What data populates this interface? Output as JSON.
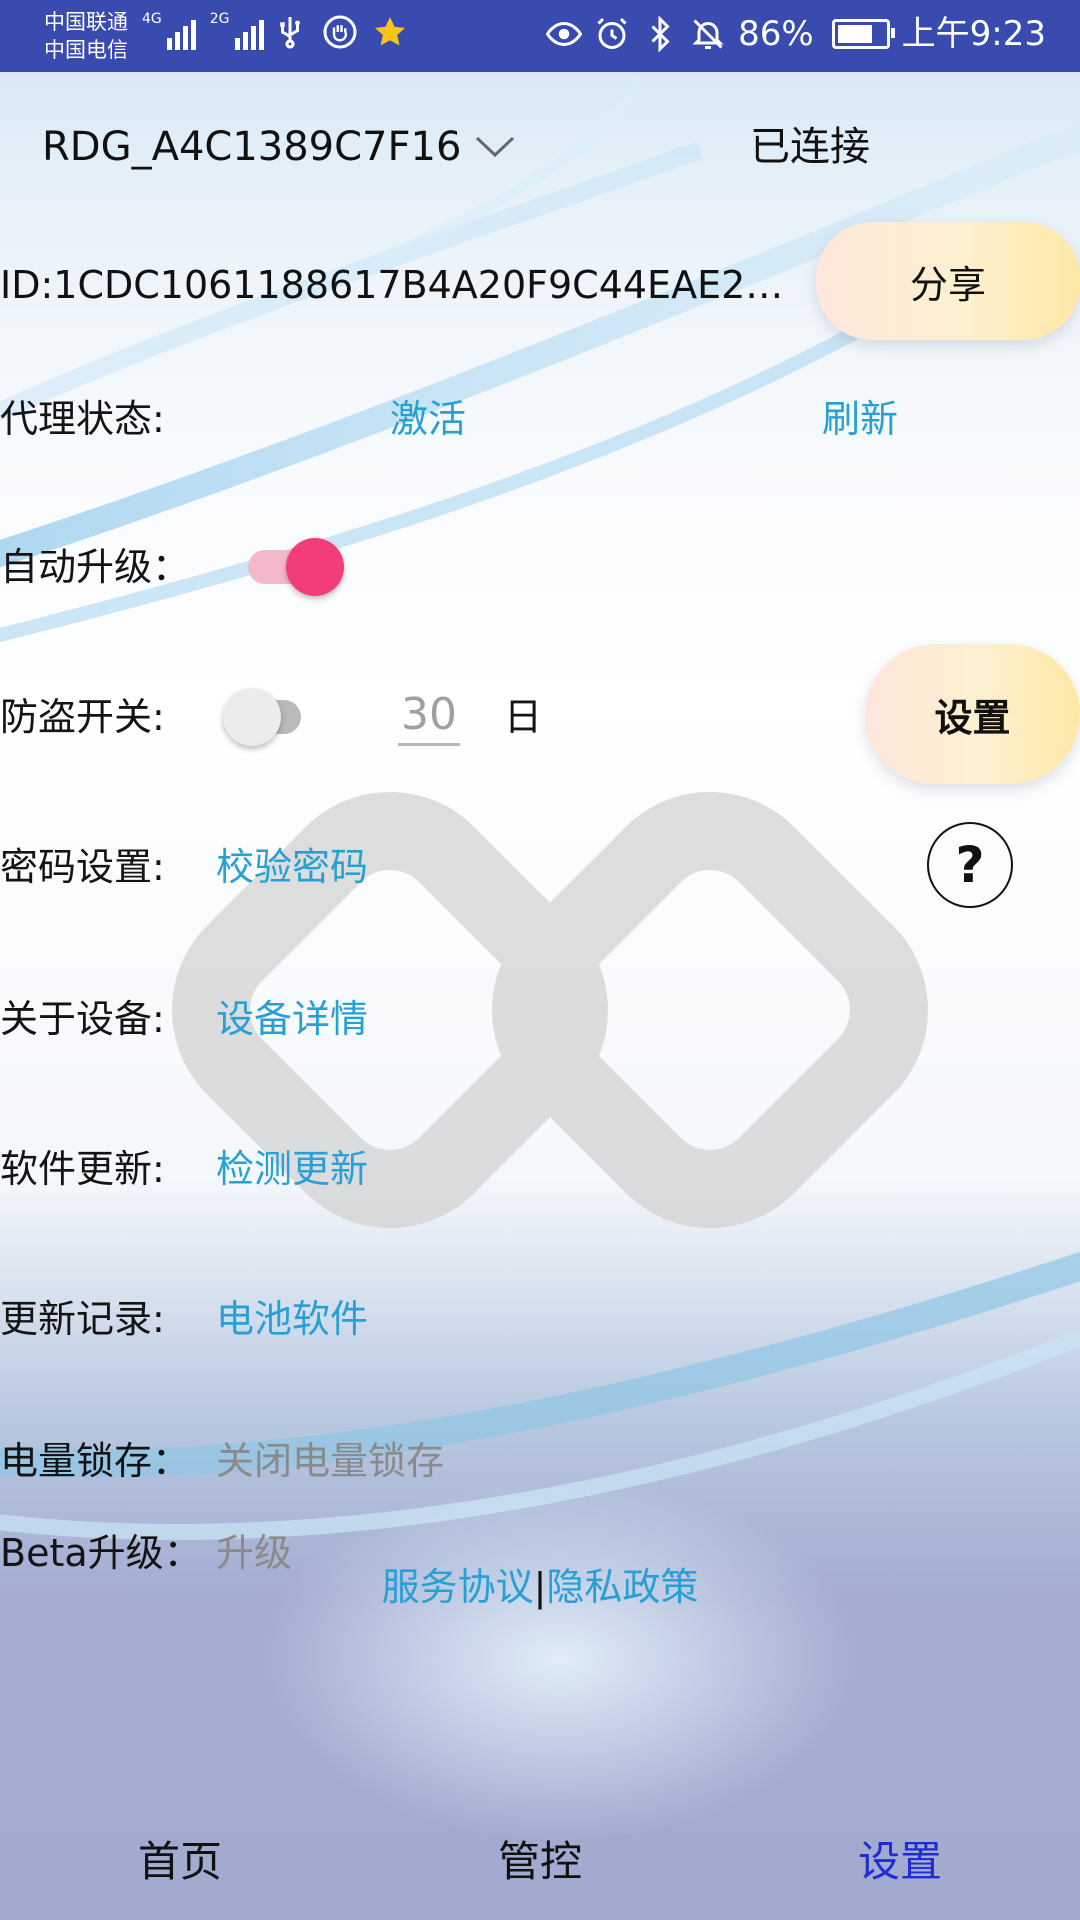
{
  "status_bar": {
    "carrier_1": "中国联通",
    "carrier_2": "中国电信",
    "net_1": "4G",
    "net_2": "2G",
    "battery_percent_text": "86%",
    "battery_level": 0.86,
    "time": "上午9:23"
  },
  "device": {
    "name": "RDG_A4C1389C7F16",
    "connection_status": "已连接",
    "id": "ID:1CDC1061188617B4A20F9C44EAE2C…",
    "share_label": "分享"
  },
  "settings": {
    "agent_status": {
      "label": "代理状态:",
      "activate": "激活",
      "refresh": "刷新"
    },
    "auto_upgrade": {
      "label": "自动升级：",
      "enabled": true
    },
    "anti_theft": {
      "label": "防盗开关:",
      "enabled": false,
      "days_value": "30",
      "days_unit": "日",
      "set_label": "设置"
    },
    "password": {
      "label": "密码设置:",
      "action": "校验密码"
    },
    "about": {
      "label": "关于设备:",
      "action": "设备详情"
    },
    "software_update": {
      "label": "软件更新:",
      "action": "检测更新"
    },
    "update_log": {
      "label": "更新记录:",
      "action": "电池软件"
    },
    "power_lock": {
      "label": "电量锁存：",
      "action": "关闭电量锁存"
    },
    "beta": {
      "label": "Beta升级：",
      "action": "升级"
    }
  },
  "footer": {
    "service_agreement": "服务协议",
    "separator": "|",
    "privacy_policy": "隐私政策"
  },
  "bottom_nav": {
    "items": [
      "首页",
      "管控",
      "设置"
    ],
    "active_index": 2
  },
  "colors": {
    "status_bar_bg": "#3a4bb0",
    "link": "#27a0d6",
    "toggle_on": "#f23d78",
    "nav_active": "#1f2bd6"
  }
}
